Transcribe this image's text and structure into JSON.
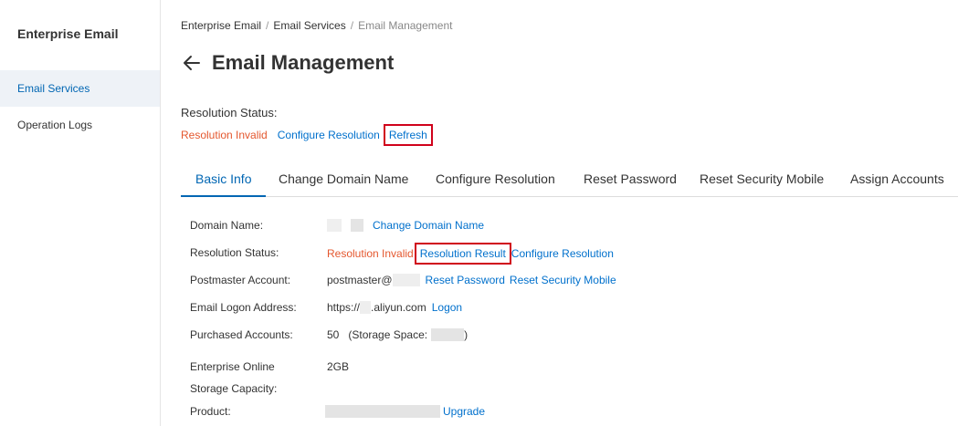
{
  "sidebar": {
    "title": "Enterprise Email",
    "items": [
      {
        "label": "Email Services",
        "active": true
      },
      {
        "label": "Operation Logs",
        "active": false
      }
    ]
  },
  "breadcrumb": [
    "Enterprise Email",
    "Email Services",
    "Email Management"
  ],
  "page": {
    "title": "Email Management",
    "back_icon": "arrow-left-icon"
  },
  "resolution": {
    "label": "Resolution Status:",
    "status": "Resolution Invalid",
    "configure": "Configure Resolution",
    "refresh": "Refresh"
  },
  "tabs": [
    "Basic Info",
    "Change Domain Name",
    "Configure Resolution",
    "Reset Password",
    "Reset Security Mobile",
    "Assign Accounts"
  ],
  "info": {
    "domain_name": {
      "label": "Domain Name:",
      "action": "Change Domain Name"
    },
    "resolution_status": {
      "label": "Resolution Status:",
      "value": "Resolution Invalid",
      "result": "Resolution Result",
      "configure": "Configure Resolution"
    },
    "postmaster": {
      "label": "Postmaster Account:",
      "value": "postmaster@",
      "reset_password": "Reset Password",
      "reset_mobile": "Reset Security Mobile"
    },
    "logon": {
      "label": "Email Logon Address:",
      "prefix": "https://",
      "suffix": ".aliyun.com",
      "action": "Logon"
    },
    "purchased": {
      "label": "Purchased Accounts:",
      "value": "50",
      "storage_prefix": "(Storage Space:",
      "storage_suffix": ")"
    },
    "storage": {
      "label_line1": "Enterprise Online",
      "label_line2": "Storage Capacity:",
      "value": "2GB"
    },
    "product": {
      "label": "Product:",
      "action": "Upgrade"
    }
  },
  "colors": {
    "accent": "#0066b3",
    "link": "#0070cc",
    "error": "#e4572e",
    "highlight_box": "#d0021b"
  }
}
